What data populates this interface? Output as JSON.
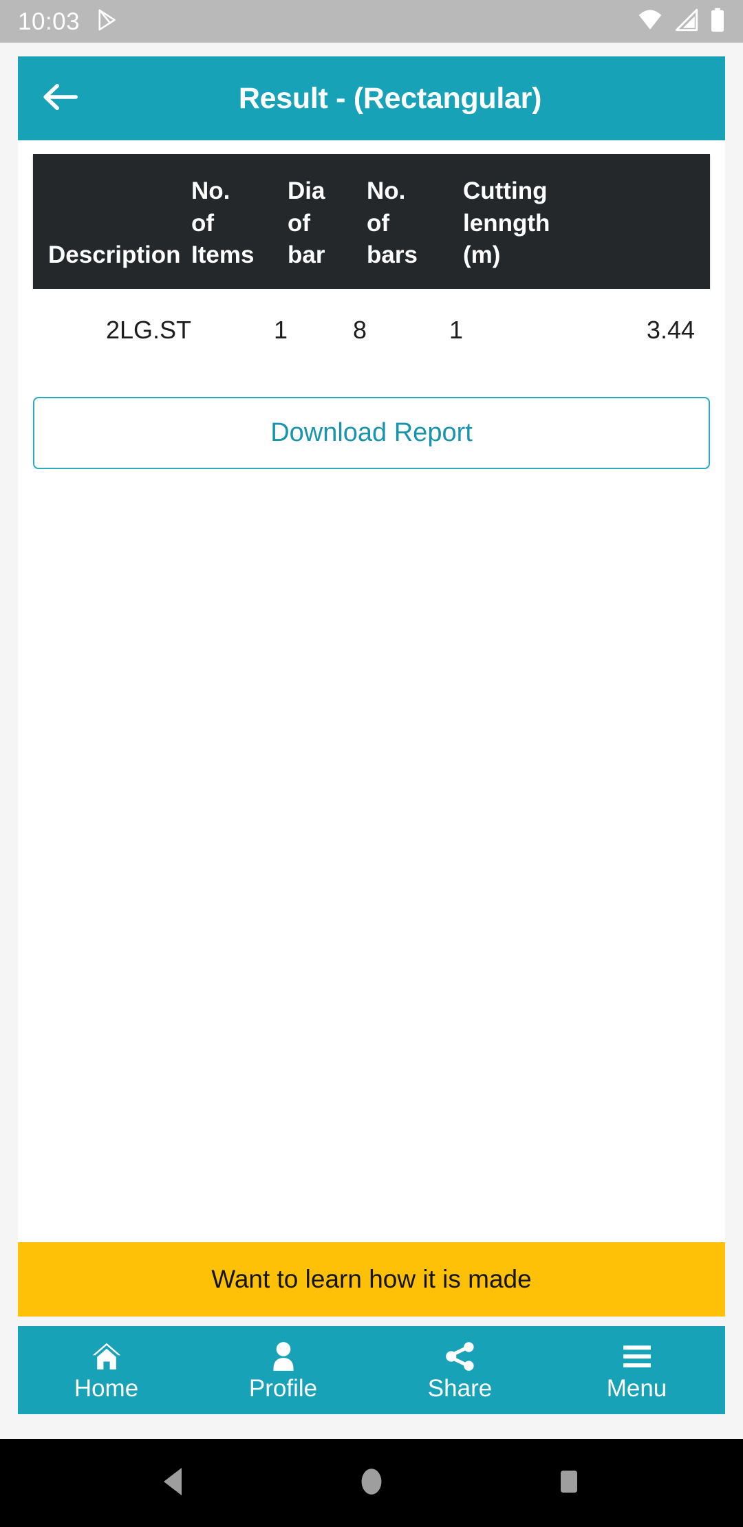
{
  "status_bar": {
    "time": "10:03",
    "icons": [
      "play-store-icon",
      "wifi-icon",
      "cellular-signal-icon",
      "battery-icon"
    ],
    "background_color": "#b9b9b9"
  },
  "app_bar": {
    "title": "Result - (Rectangular)",
    "back_icon": "back-arrow-icon",
    "background_color": "#17a2b8"
  },
  "table": {
    "header_background": "#24282b",
    "columns": [
      "Description",
      "No.\nof\nItems",
      "Dia\nof\nbar",
      "No.\nof\nbars",
      "Cutting\nlenngth\n(m)"
    ],
    "rows": [
      {
        "description": "2LG.ST",
        "no_of_items": "1",
        "dia_of_bar": "8",
        "no_of_bars": "1",
        "cutting_length": "3.44"
      }
    ]
  },
  "download_button": {
    "label": "Download Report",
    "accent_color": "#1895ad"
  },
  "promo_banner": {
    "label": "Want to learn how it is made",
    "background_color": "#ffc107"
  },
  "bottom_nav": {
    "background_color": "#17a2b8",
    "items": [
      {
        "label": "Home",
        "icon": "home-icon"
      },
      {
        "label": "Profile",
        "icon": "person-icon"
      },
      {
        "label": "Share",
        "icon": "share-icon"
      },
      {
        "label": "Menu",
        "icon": "hamburger-menu-icon"
      }
    ]
  },
  "system_nav": {
    "buttons": [
      {
        "icon": "android-back-icon"
      },
      {
        "icon": "android-home-icon"
      },
      {
        "icon": "android-recents-icon"
      }
    ]
  }
}
